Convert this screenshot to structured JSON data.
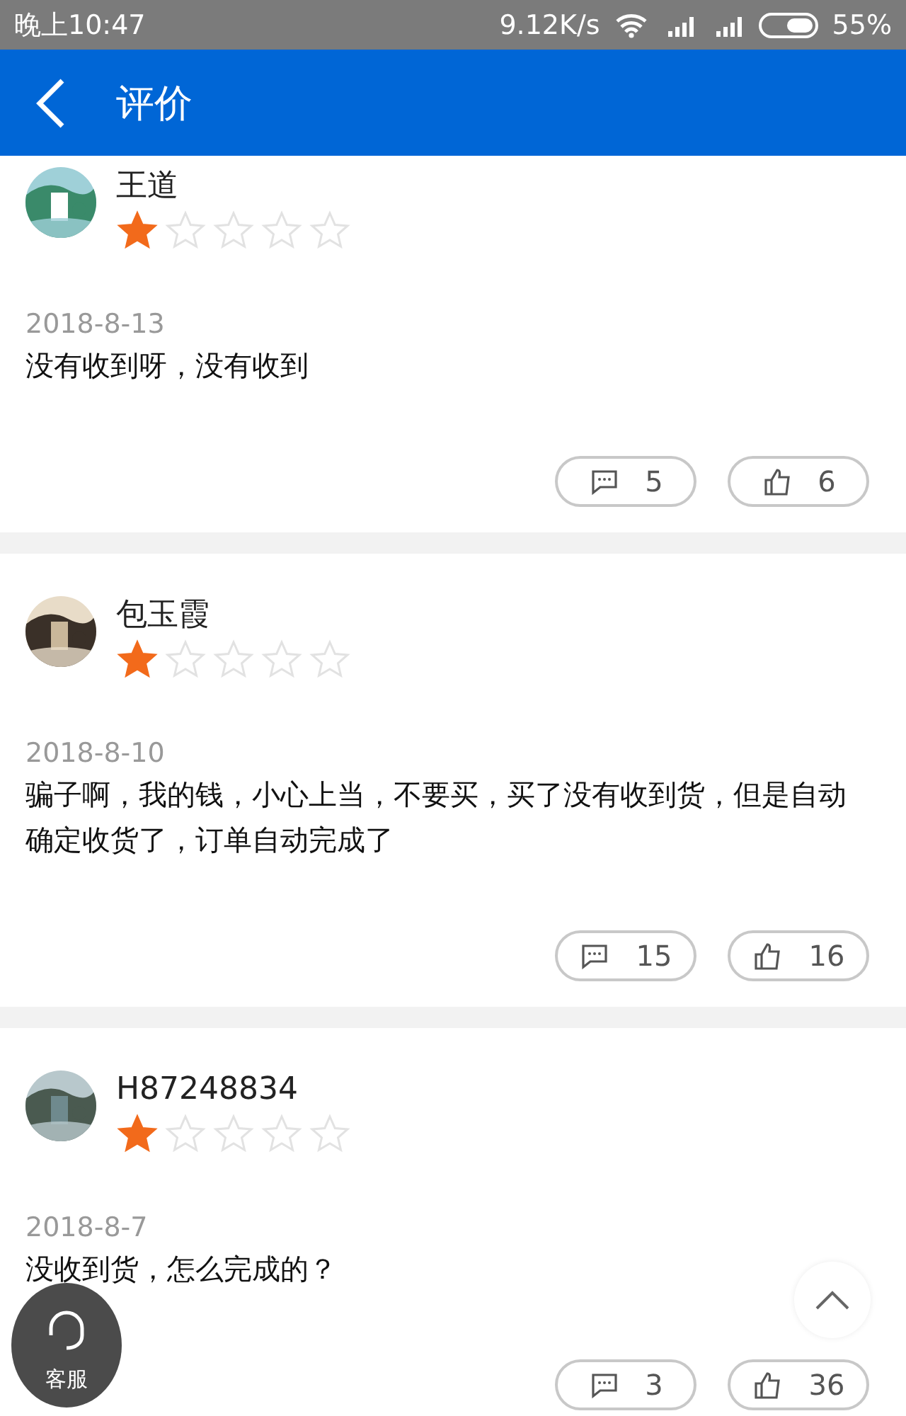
{
  "status_bar": {
    "time": "晚上10:47",
    "net_speed": "9.12K/s",
    "battery": "55%"
  },
  "header": {
    "title": "评价"
  },
  "reviews": [
    {
      "user": "王道",
      "stars": 1,
      "date": "2018-8-13",
      "text": "没有收到呀，没有收到",
      "comments": "5",
      "likes": "6"
    },
    {
      "user": "包玉霞",
      "stars": 1,
      "date": "2018-8-10",
      "text": "骗子啊，我的钱，小心上当，不要买，买了没有收到货，但是自动确定收货了，订单自动完成了",
      "comments": "15",
      "likes": "16"
    },
    {
      "user": "H87248834",
      "stars": 1,
      "date": "2018-8-7",
      "text": "没收到货，怎么完成的？",
      "comments": "3",
      "likes": "36"
    }
  ],
  "service_button": {
    "label": "客服"
  }
}
